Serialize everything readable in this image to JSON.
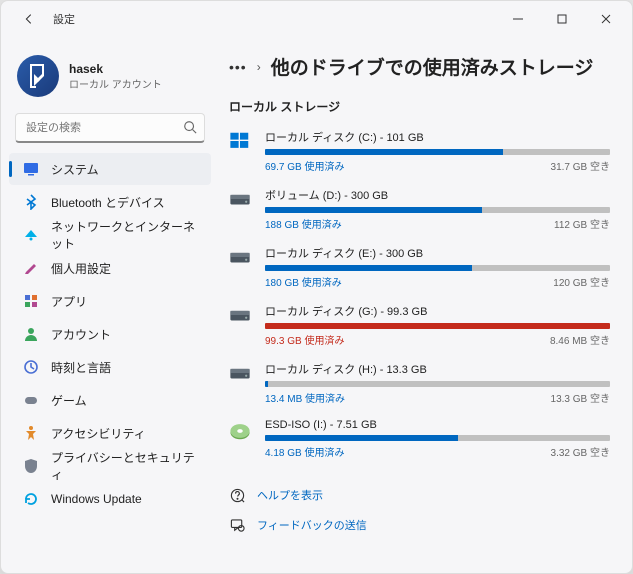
{
  "window": {
    "title": "設定"
  },
  "user": {
    "name": "hasek",
    "sub": "ローカル アカウント"
  },
  "search": {
    "placeholder": "設定の検索"
  },
  "nav": {
    "items": [
      {
        "label": "システム",
        "icon": "system",
        "color": "#2f6be4",
        "active": true
      },
      {
        "label": "Bluetooth とデバイス",
        "icon": "bluetooth",
        "color": "#0078d4"
      },
      {
        "label": "ネットワークとインターネット",
        "icon": "network",
        "color": "#00b0e8"
      },
      {
        "label": "個人用設定",
        "icon": "personalization",
        "color": "#b14890"
      },
      {
        "label": "アプリ",
        "icon": "apps",
        "color": "#4a6fd4"
      },
      {
        "label": "アカウント",
        "icon": "account",
        "color": "#3ba55d"
      },
      {
        "label": "時刻と言語",
        "icon": "time",
        "color": "#4a6fd4"
      },
      {
        "label": "ゲーム",
        "icon": "gaming",
        "color": "#7a8290"
      },
      {
        "label": "アクセシビリティ",
        "icon": "accessibility",
        "color": "#e28a2b"
      },
      {
        "label": "プライバシーとセキュリティ",
        "icon": "privacy",
        "color": "#7a8290"
      },
      {
        "label": "Windows Update",
        "icon": "update",
        "color": "#00a1e0"
      }
    ]
  },
  "breadcrumb": {
    "title": "他のドライブでの使用済みストレージ"
  },
  "section": {
    "title": "ローカル ストレージ"
  },
  "drives": [
    {
      "name": "ローカル ディスク (C:) - 101 GB",
      "used": "69.7 GB 使用済み",
      "free": "31.7 GB 空き",
      "percent": 69,
      "fillColor": "#0067c0",
      "icon": "windows"
    },
    {
      "name": "ボリューム (D:) - 300 GB",
      "used": "188 GB 使用済み",
      "free": "112 GB 空き",
      "percent": 63,
      "fillColor": "#0067c0",
      "icon": "hdd"
    },
    {
      "name": "ローカル ディスク (E:) - 300 GB",
      "used": "180 GB 使用済み",
      "free": "120 GB 空き",
      "percent": 60,
      "fillColor": "#0067c0",
      "icon": "hdd"
    },
    {
      "name": "ローカル ディスク (G:) - 99.3 GB",
      "used": "99.3 GB 使用済み",
      "free": "8.46 MB 空き",
      "percent": 100,
      "fillColor": "#c42b1c",
      "icon": "hdd",
      "warn": true
    },
    {
      "name": "ローカル ディスク (H:) - 13.3 GB",
      "used": "13.4 MB 使用済み",
      "free": "13.3 GB 空き",
      "percent": 1,
      "fillColor": "#0067c0",
      "icon": "hdd"
    },
    {
      "name": "ESD-ISO (I:) - 7.51 GB",
      "used": "4.18 GB 使用済み",
      "free": "3.32 GB 空き",
      "percent": 56,
      "fillColor": "#0067c0",
      "icon": "iso"
    }
  ],
  "links": {
    "help": "ヘルプを表示",
    "feedback": "フィードバックの送信"
  }
}
